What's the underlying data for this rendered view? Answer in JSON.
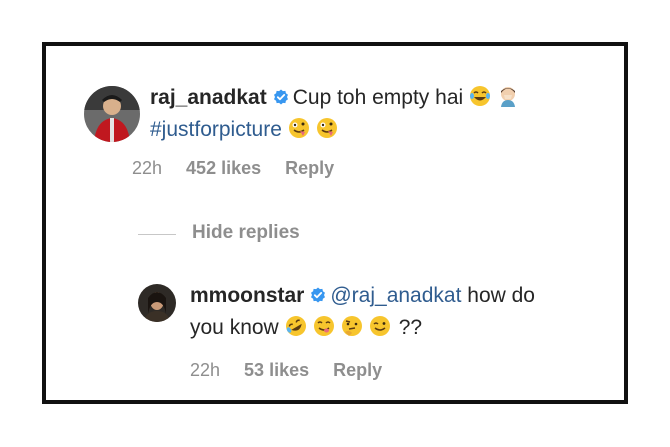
{
  "comment": {
    "username": "raj_anadkat",
    "text": "Cup toh empty hai",
    "hashtag": "#justforpicture",
    "time": "22h",
    "likes": "452 likes",
    "reply": "Reply"
  },
  "hide_replies": "Hide replies",
  "reply": {
    "username": "mmoonstar",
    "mention": "@raj_anadkat",
    "text_part1": " how do",
    "text_part2": "you know",
    "text_suffix": "??",
    "time": "22h",
    "likes": "53 likes",
    "reply": "Reply"
  },
  "colors": {
    "hashtag": "#2f5c8f",
    "meta": "#8e8e8e",
    "verified": "#3897f0",
    "frame": "#111111"
  },
  "icons": [
    "verified-badge-icon",
    "laughing-tears-emoji",
    "facepalm-emoji",
    "zany-face-emoji",
    "rofl-emoji",
    "yum-emoji",
    "thinking-emoji",
    "wink-emoji"
  ]
}
